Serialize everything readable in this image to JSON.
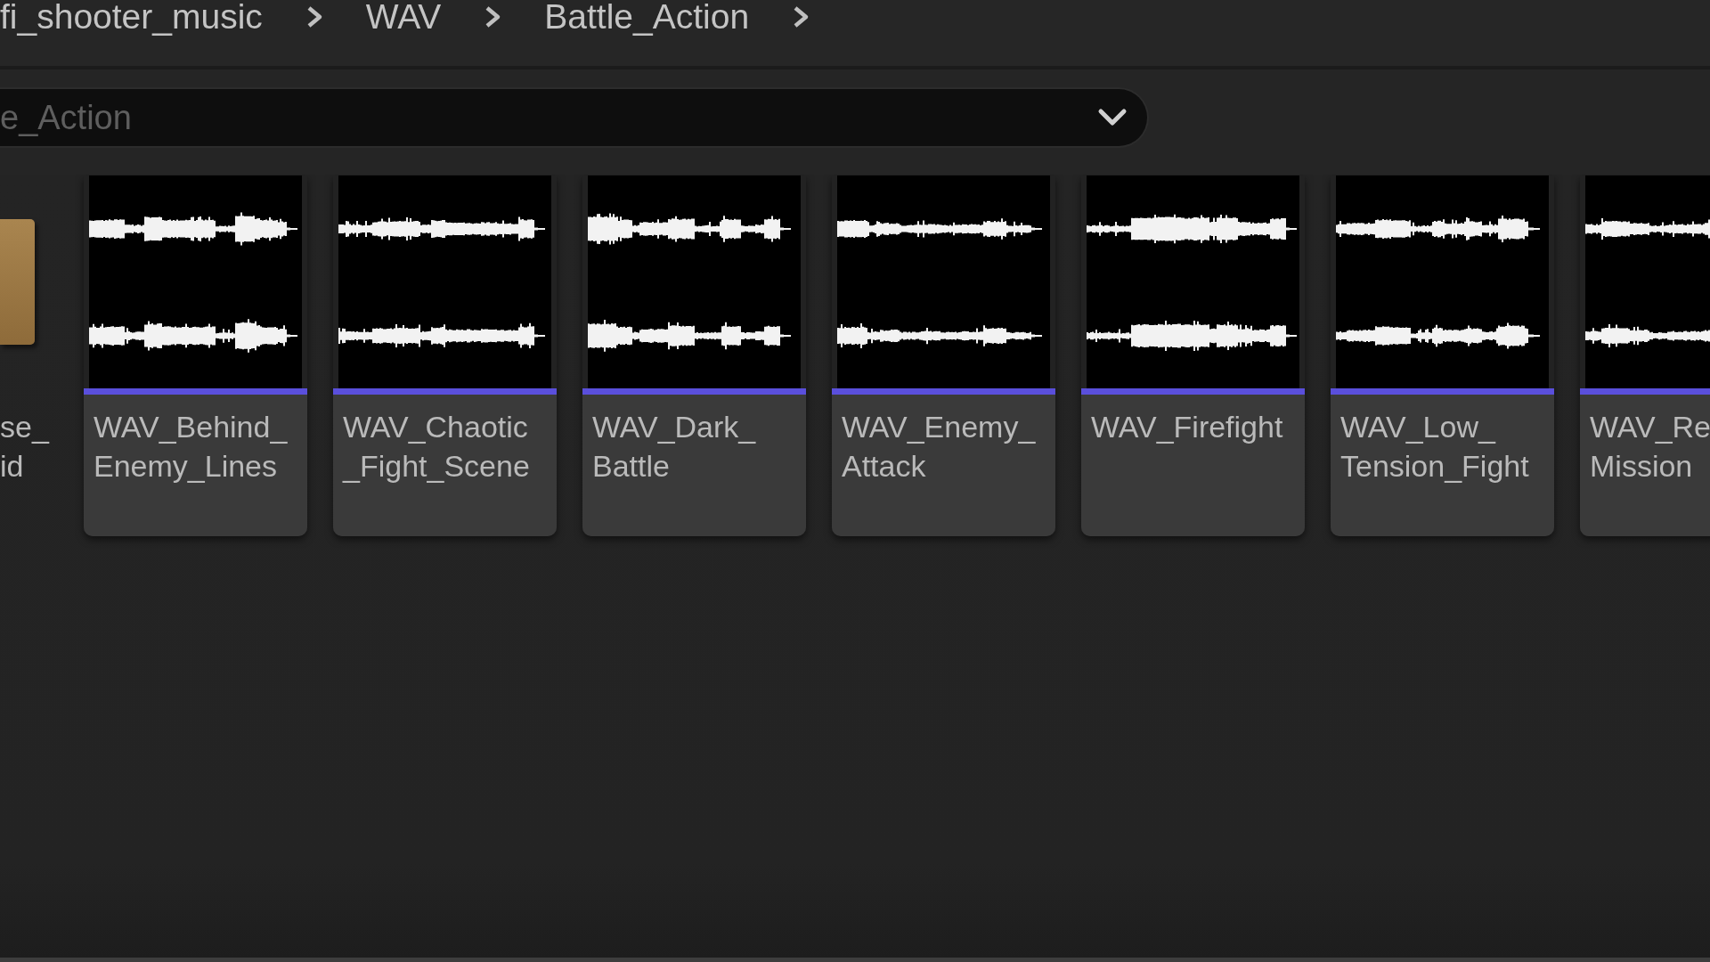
{
  "breadcrumb": [
    {
      "label": "fi_shooter_music"
    },
    {
      "label": "WAV"
    },
    {
      "label": "Battle_Action"
    }
  ],
  "search": {
    "placeholder": "e_Action"
  },
  "items": [
    {
      "kind": "folder",
      "name": "se_\nid",
      "selected": false
    },
    {
      "kind": "sound_wave",
      "name": "WAV_Behind_\nEnemy_Lines",
      "selected": false
    },
    {
      "kind": "sound_wave",
      "name": "WAV_Chaotic\n_Fight_Scene",
      "selected": false
    },
    {
      "kind": "sound_wave",
      "name": "WAV_Dark_\nBattle",
      "selected": false
    },
    {
      "kind": "sound_wave",
      "name": "WAV_Enemy_\nAttack",
      "selected": false
    },
    {
      "kind": "sound_wave",
      "name": "WAV_Firefight",
      "selected": false
    },
    {
      "kind": "sound_wave",
      "name": "WAV_Low_\nTension_Fight",
      "selected": false
    },
    {
      "kind": "sound_wave",
      "name": "WAV_Re\nMission",
      "selected": false
    }
  ]
}
